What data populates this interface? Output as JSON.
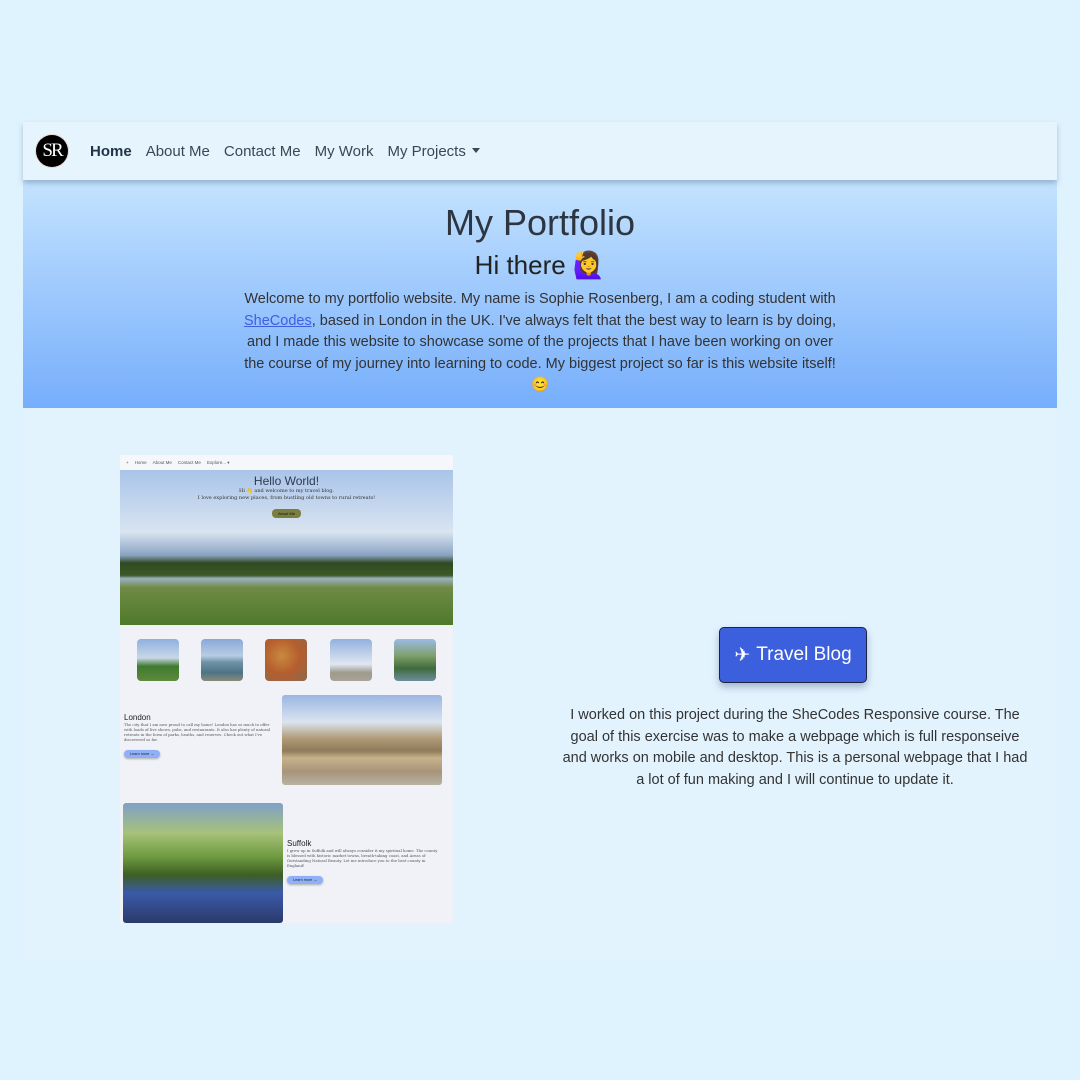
{
  "navbar": {
    "logo_text": "SR",
    "links": [
      "Home",
      "About Me",
      "Contact Me",
      "My Work",
      "My Projects"
    ],
    "active": "Home"
  },
  "hero": {
    "title": "My Portfolio",
    "greeting": "Hi there 🙋‍♀️",
    "intro_before_link": "Welcome to my portfolio website. My name is Sophie Rosenberg, I am a coding student with ",
    "link_text": "SheCodes",
    "intro_after_link": ", based in London in the UK. I've always felt that the best way to learn is by doing, and I made this website to showcase some of the projects that I have been working on over the course of my journey into learning to code. My biggest project so far is this website itself! 😊"
  },
  "preview": {
    "nav": [
      "+",
      "Home",
      "About Me",
      "Contact Me",
      "Explore... ▾"
    ],
    "title": "Hello World!",
    "subtitle_1": "Hi 👋 and welcome to my travel blog.",
    "subtitle_2": "I love exploring new places, from bustling old towns to rural retreats!",
    "button": "About Me",
    "sections": [
      {
        "title": "London",
        "text": "The city that I am now proud to call my home! London has so much to offer with loads of live shows, pubs, and restaurants. It also has plenty of natural retreats in the form of parks, heaths, and reserves. Check out what I've discovered so far.",
        "button": "Learn more →"
      },
      {
        "title": "Suffolk",
        "text": "I grew up in Suffolk and will always consider it my spiritual home. The county is blessed with historic market towns, breath-taking coast, and Areas of Outstanding Natural Beauty. Let me introduce you to the best county in England!",
        "button": "Learn more →"
      }
    ]
  },
  "project": {
    "button_icon": "✈",
    "button_label": "Travel Blog",
    "description": "I worked on this project during the SheCodes Responsive course. The goal of this exercise was to make a webpage which is full responseive and works on mobile and desktop. This is a personal webpage that I had a lot of fun making and I will continue to update it."
  },
  "colors": {
    "accent": "#3c5fde",
    "hero_top": "#c4e3fe",
    "hero_bottom": "#76aefc",
    "background": "#dff3fe"
  }
}
